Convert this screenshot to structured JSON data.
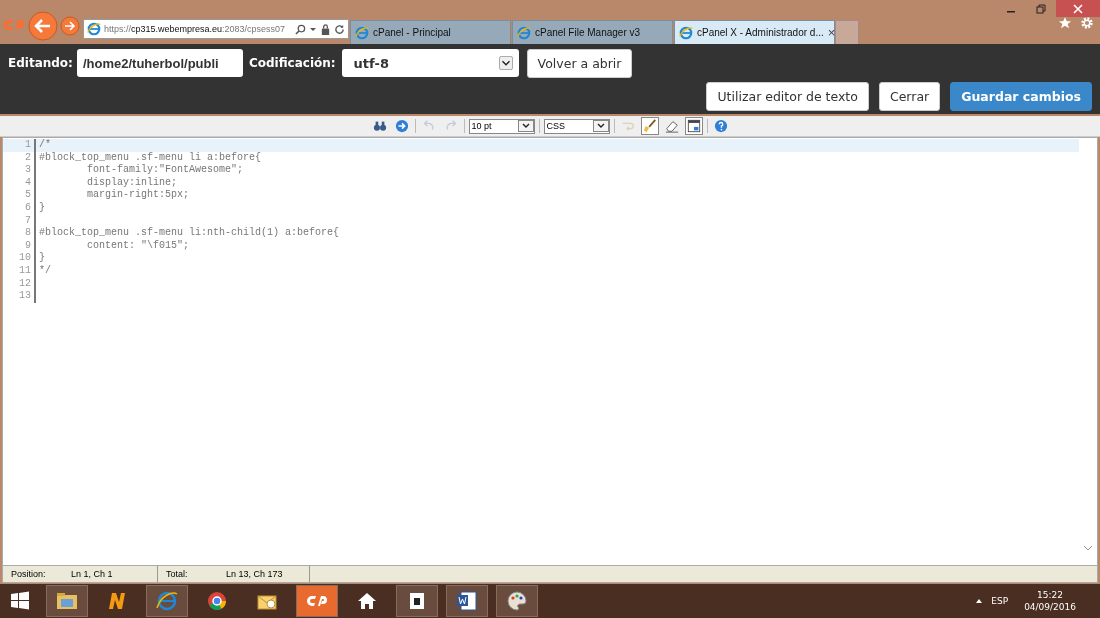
{
  "browser": {
    "address": {
      "scheme": "https://",
      "host": "cp315.webempresa.eu",
      "rest": ":2083/cpsess07"
    },
    "tabs": [
      {
        "label": "cPanel - Principal",
        "selected": false,
        "closable": false
      },
      {
        "label": "cPanel File Manager v3",
        "selected": false,
        "closable": false
      },
      {
        "label": "cPanel X - Administrador d...",
        "selected": true,
        "closable": true
      }
    ],
    "close_glyph": "×"
  },
  "header": {
    "path_label": "Editando:",
    "path_value": "/home2/tuherbol/publi",
    "encoding_label": "Codificación:",
    "encoding_value": "utf-8",
    "reopen_button": "Volver a abrir",
    "buttons": [
      {
        "label": "Utilizar editor de texto",
        "kind": "plain"
      },
      {
        "label": "Cerrar",
        "kind": "plain"
      },
      {
        "label": "Guardar cambios",
        "kind": "primary"
      }
    ]
  },
  "toolbar": {
    "items": [
      {
        "kind": "search",
        "disabled": false,
        "on": false
      },
      {
        "kind": "goto",
        "disabled": false,
        "on": false
      },
      {
        "kind": "sep"
      },
      {
        "kind": "undo",
        "disabled": true,
        "on": false
      },
      {
        "kind": "redo",
        "disabled": true,
        "on": false
      },
      {
        "kind": "sep"
      },
      {
        "kind": "fontsize",
        "value": "10 pt"
      },
      {
        "kind": "sep"
      },
      {
        "kind": "syntax",
        "value": "CSS"
      },
      {
        "kind": "sep"
      },
      {
        "kind": "wrap",
        "disabled": true,
        "on": false
      },
      {
        "kind": "highlight",
        "disabled": false,
        "on": true
      },
      {
        "kind": "eraser",
        "disabled": false,
        "on": false
      },
      {
        "kind": "fullscreen",
        "disabled": false,
        "on": true
      },
      {
        "kind": "sep"
      },
      {
        "kind": "help",
        "disabled": false,
        "on": false
      }
    ]
  },
  "editor": {
    "lines": [
      {
        "number": "1",
        "text": "/*",
        "selected": true
      },
      {
        "number": "2",
        "text": "#block_top_menu .sf-menu li a:before{",
        "selected": false
      },
      {
        "number": "3",
        "text": "\tfont-family:\"FontAwesome\";",
        "selected": false
      },
      {
        "number": "4",
        "text": "\tdisplay:inline;",
        "selected": false
      },
      {
        "number": "5",
        "text": "\tmargin-right:5px;",
        "selected": false
      },
      {
        "number": "6",
        "text": "}",
        "selected": false
      },
      {
        "number": "7",
        "selected": false
      },
      {
        "number": "8",
        "text": "#block_top_menu .sf-menu li:nth-child(1) a:before{",
        "selected": false
      },
      {
        "number": "9",
        "text": "\tcontent: \"\\f015\";",
        "selected": false
      },
      {
        "number": "10",
        "text": "}",
        "selected": false
      },
      {
        "number": "11",
        "text": "*/",
        "selected": false
      },
      {
        "number": "12",
        "selected": false
      },
      {
        "number": "13",
        "selected": false
      }
    ]
  },
  "status_bar": {
    "position_label": "Position:",
    "position_value": "Ln 1, Ch 1",
    "total_label": "Total:",
    "total_value": "Ln 13, Ch 173"
  },
  "taskbar": {
    "apps": [
      {
        "kind": "folder",
        "open": true
      },
      {
        "kind": "n",
        "open": false
      },
      {
        "kind": "ie",
        "open": true
      },
      {
        "kind": "chrome",
        "open": false
      },
      {
        "kind": "mail",
        "open": false
      },
      {
        "kind": "cpanel",
        "open": true
      },
      {
        "kind": "home",
        "open": false
      },
      {
        "kind": "bag",
        "open": true
      },
      {
        "kind": "word",
        "open": true
      },
      {
        "kind": "paint",
        "open": true
      }
    ],
    "language": "ESP",
    "time": "15:22",
    "date": "04/09/2016"
  }
}
